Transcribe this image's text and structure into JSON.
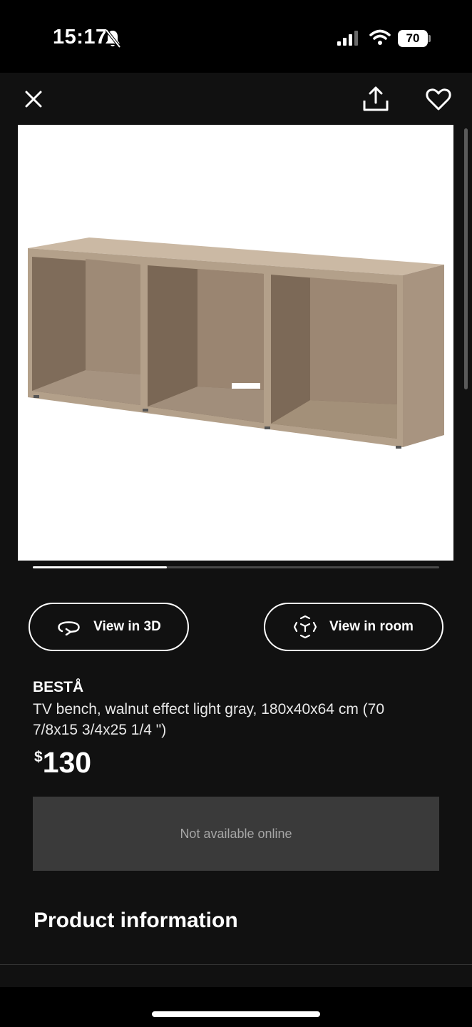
{
  "status": {
    "time": "15:17",
    "battery": "70"
  },
  "toolbar": {
    "close_icon": "close-icon",
    "share_icon": "share-icon",
    "favorite_icon": "heart-icon"
  },
  "carousel": {
    "position_fraction": 0.33
  },
  "actions": {
    "view_3d": "View in 3D",
    "view_room": "View in room"
  },
  "product": {
    "name": "BESTÅ",
    "description": "TV bench, walnut effect light gray, 180x40x64 cm (70 7/8x15 3/4x25 1/4 \")",
    "currency_symbol": "$",
    "price": "130",
    "availability": "Not available online"
  },
  "sections": {
    "product_information": "Product information"
  },
  "colors": {
    "background": "#111111",
    "wood": "#b9a58f"
  }
}
